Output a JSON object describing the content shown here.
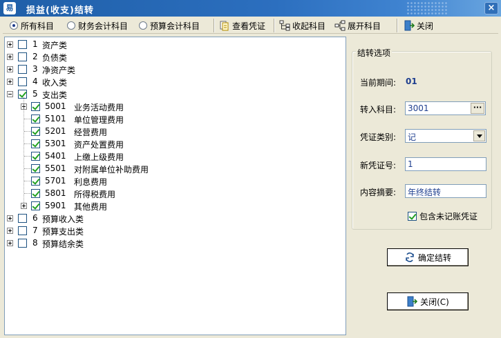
{
  "window": {
    "title": "损益(收支)结转",
    "app_icon": "易",
    "close_glyph": "×"
  },
  "toolbar": {
    "radio_all": "所有科目",
    "radio_finance": "财务会计科目",
    "radio_budget": "预算会计科目",
    "view_voucher": "查看凭证",
    "collapse": "收起科目",
    "expand": "展开科目",
    "close": "关闭"
  },
  "tree": [
    {
      "code": "1",
      "name": "资产类",
      "checked": false
    },
    {
      "code": "2",
      "name": "负债类",
      "checked": false
    },
    {
      "code": "3",
      "name": "净资产类",
      "checked": false
    },
    {
      "code": "4",
      "name": "收入类",
      "checked": false
    },
    {
      "code": "5",
      "name": "支出类",
      "checked": true
    },
    {
      "code": "5001",
      "name": "业务活动费用",
      "checked": true
    },
    {
      "code": "5101",
      "name": "单位管理费用",
      "checked": true
    },
    {
      "code": "5201",
      "name": "经营费用",
      "checked": true
    },
    {
      "code": "5301",
      "name": "资产处置费用",
      "checked": true
    },
    {
      "code": "5401",
      "name": "上缴上级费用",
      "checked": true
    },
    {
      "code": "5501",
      "name": "对附属单位补助费用",
      "checked": true
    },
    {
      "code": "5701",
      "name": "利息费用",
      "checked": true
    },
    {
      "code": "5801",
      "name": "所得税费用",
      "checked": true
    },
    {
      "code": "5901",
      "name": "其他费用",
      "checked": true
    },
    {
      "code": "6",
      "name": "预算收入类",
      "checked": false
    },
    {
      "code": "7",
      "name": "预算支出类",
      "checked": false
    },
    {
      "code": "8",
      "name": "预算结余类",
      "checked": false
    }
  ],
  "options": {
    "group_title": "结转选项",
    "period_label": "当前期间:",
    "period_value": "01",
    "account_label": "转入科目:",
    "account_value": "3001",
    "account_btn": "···",
    "voucher_type_label": "凭证类别:",
    "voucher_type_value": "记",
    "voucher_no_label": "新凭证号:",
    "voucher_no_value": "1",
    "summary_label": "内容摘要:",
    "summary_value": "年终结转",
    "include_unposted": "包含未记账凭证"
  },
  "actions": {
    "confirm": "确定结转",
    "close": "关闭(C)"
  }
}
